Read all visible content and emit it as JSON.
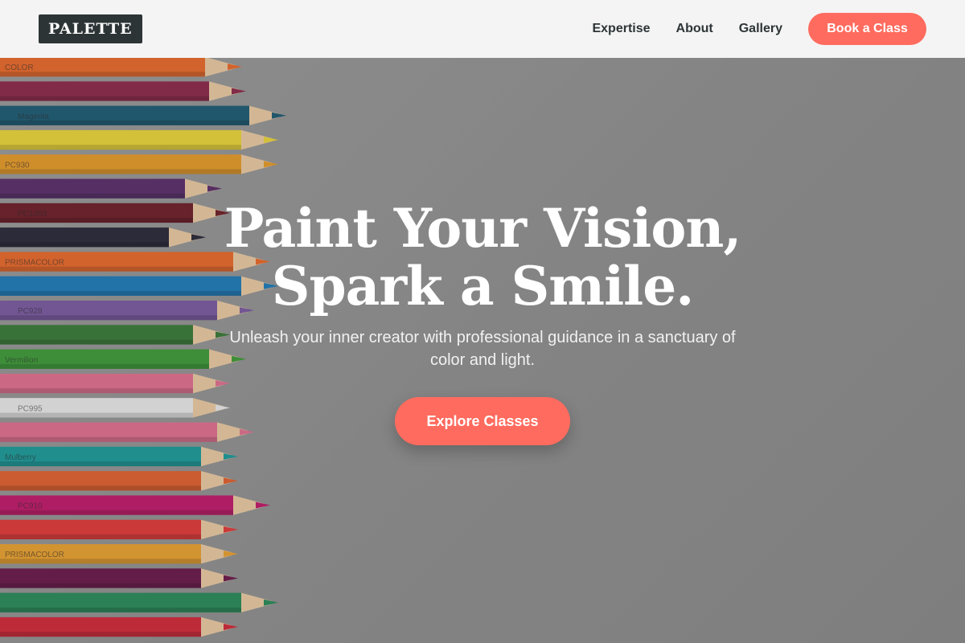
{
  "header": {
    "logo": "PALETTE",
    "nav": [
      {
        "label": "Expertise"
      },
      {
        "label": "About"
      },
      {
        "label": "Gallery"
      }
    ],
    "cta_label": "Book a Class"
  },
  "hero": {
    "headline_line1": "Paint Your Vision,",
    "headline_line2": "Spark a Smile.",
    "subtitle_line1": "Unleash your inner creator with professional guidance in a sanctuary of",
    "subtitle_line2": "color and light.",
    "button_label": "Explore Classes",
    "pencil_colors": [
      "#e8692c",
      "#8c2a4a",
      "#1e5c74",
      "#e9d43a",
      "#e59a2a",
      "#5a2e6a",
      "#6e1f2a",
      "#2a2a3a",
      "#e8692c",
      "#1f7bb8",
      "#7a5aa0",
      "#3a7a3a",
      "#3f9a3a",
      "#e07090",
      "#e8e8e8",
      "#e07090",
      "#1e9a9a",
      "#e06030",
      "#c01a6a",
      "#e03a3a",
      "#e8a030",
      "#6a1a4a",
      "#2a8a5a",
      "#d02a3a"
    ],
    "pencil_labels": [
      "COLOR",
      "Magenta",
      "PC930",
      "PC1003",
      "PRISMACOLOR",
      "PC928",
      "Vermilion",
      "PC995",
      "Mulberry",
      "PC910",
      "PRISMACOLOR"
    ]
  },
  "colors": {
    "accent": "#ff6b5e",
    "logo_bg": "#2d3436",
    "header_bg": "#f4f4f4"
  }
}
